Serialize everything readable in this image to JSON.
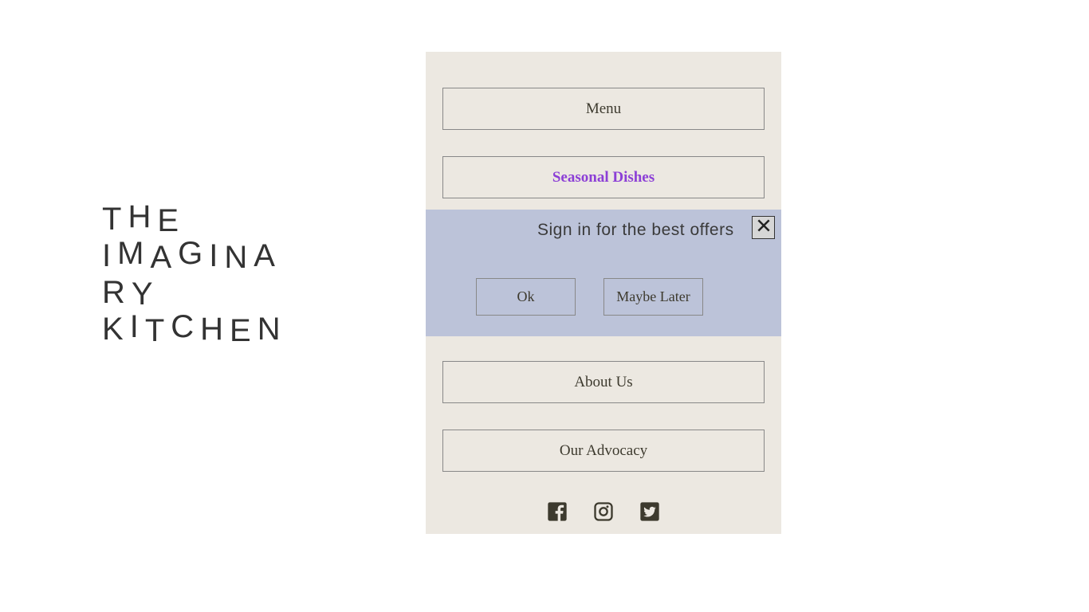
{
  "brand": {
    "line1": "The",
    "line2": "Imagina",
    "line3": "ry",
    "line4": "Kitchen"
  },
  "nav": {
    "menu": "Menu",
    "seasonal": "Seasonal Dishes",
    "about": "About Us",
    "advocacy": "Our Advocacy"
  },
  "notice": {
    "text": "Sign in for the best offers",
    "ok": "Ok",
    "later": "Maybe Later"
  },
  "colors": {
    "panel_bg": "#ece8e1",
    "notice_bg": "#bcc3d9",
    "highlight": "#8c3fd6",
    "text": "#3d3a2e"
  }
}
